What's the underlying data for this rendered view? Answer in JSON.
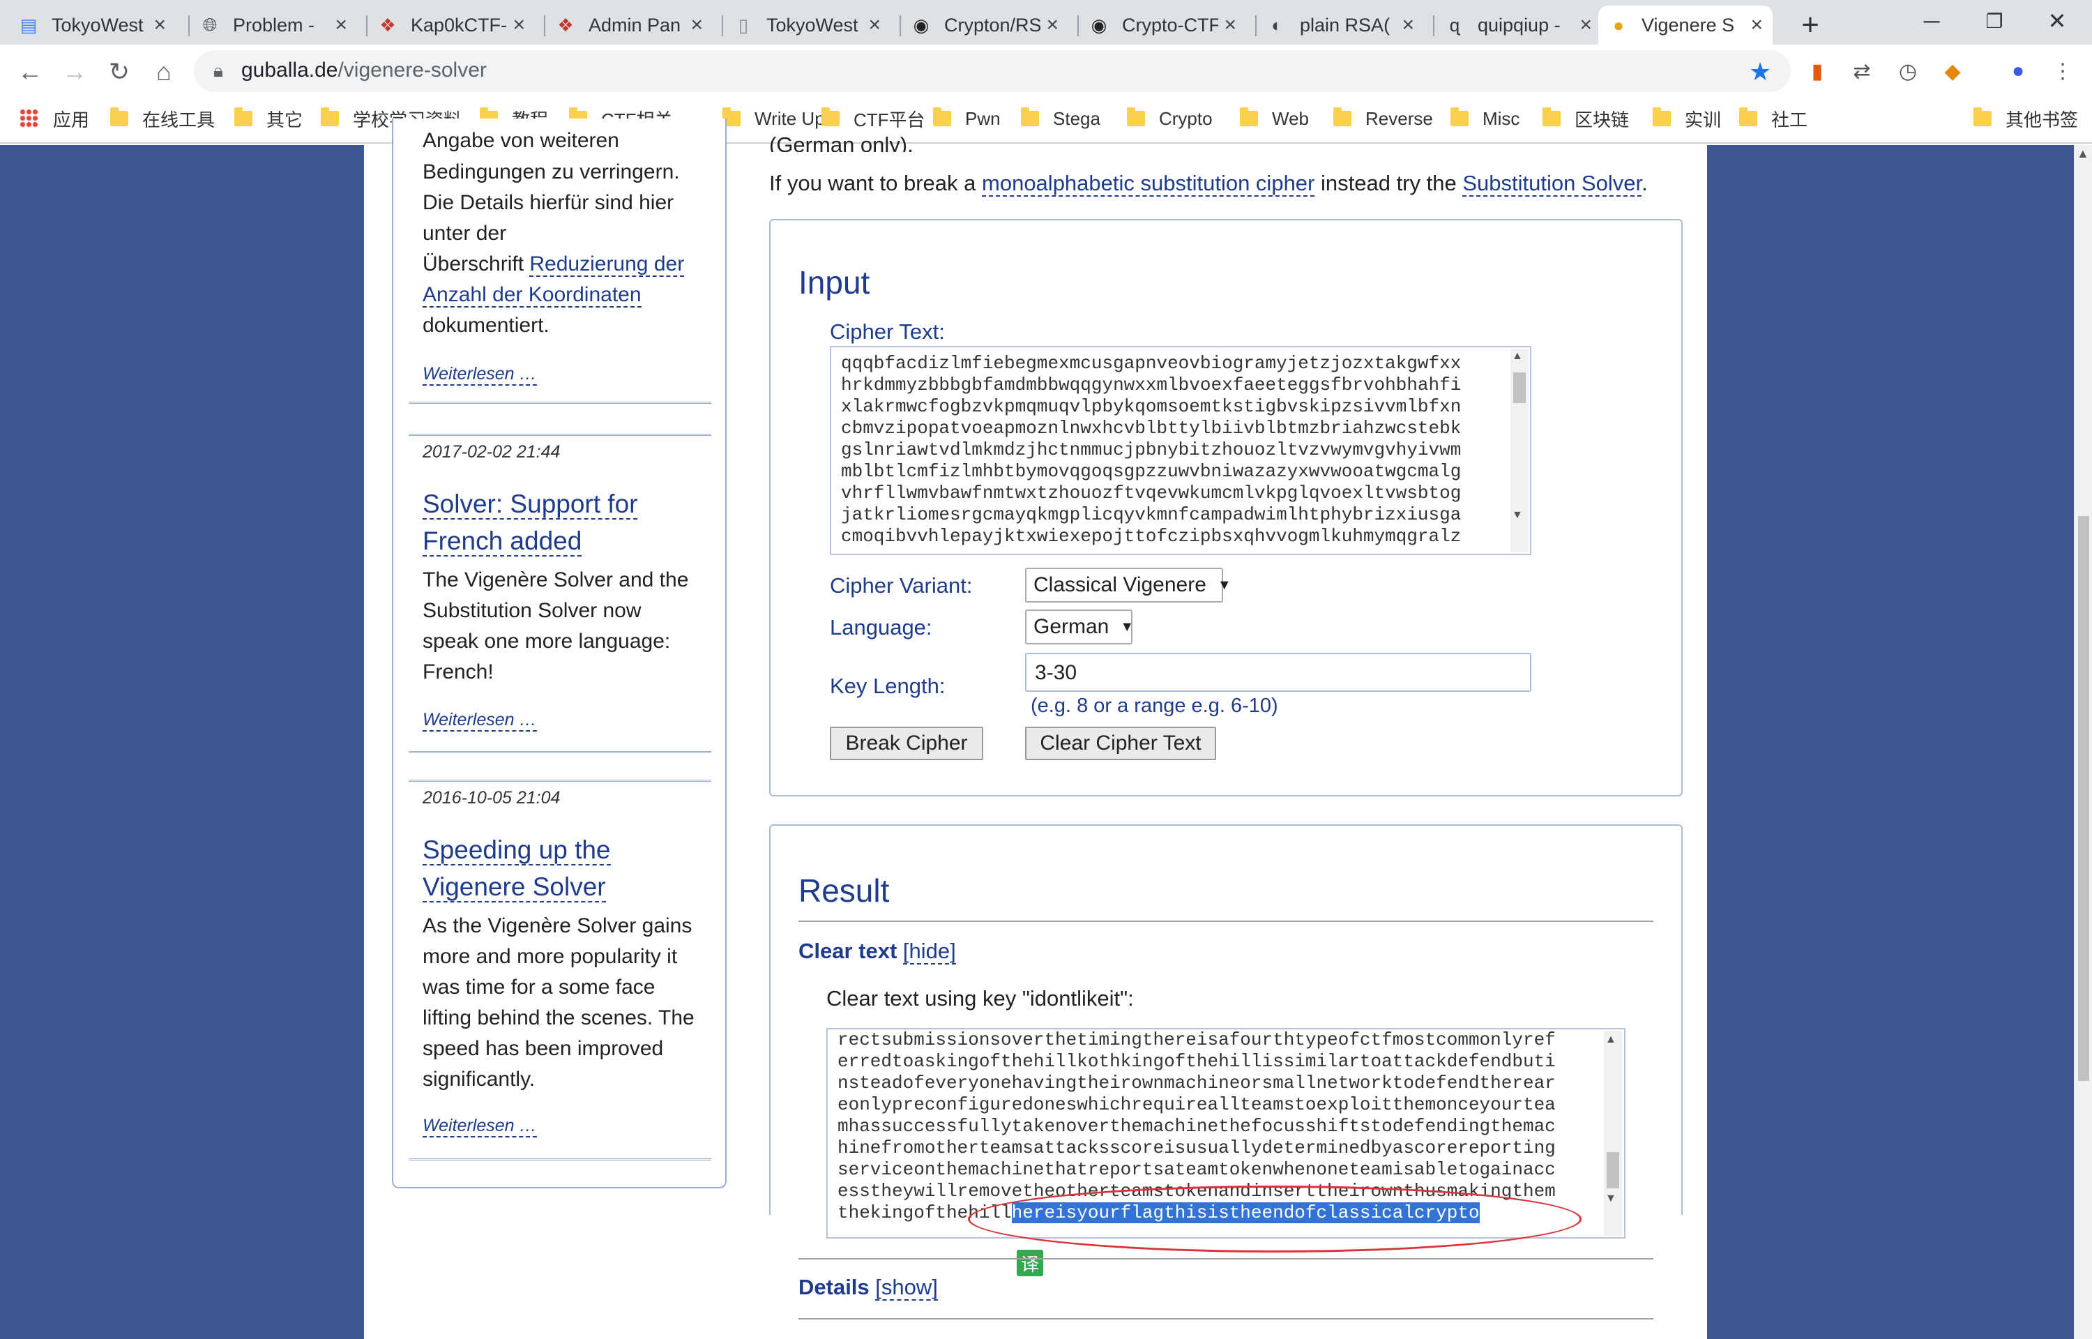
{
  "browser": {
    "tabs": [
      {
        "title": "TokyoWest",
        "icon": "docs-icon"
      },
      {
        "title": "Problem -",
        "icon": "globe-icon"
      },
      {
        "title": "Kap0kCTF-",
        "icon": "ctf-icon"
      },
      {
        "title": "Admin Pan",
        "icon": "ctf-icon"
      },
      {
        "title": "TokyoWest",
        "icon": "page-icon"
      },
      {
        "title": "Crypton/RS",
        "icon": "github-icon"
      },
      {
        "title": "Crypto-CTF",
        "icon": "github-icon"
      },
      {
        "title": "plain RSA(",
        "icon": "rsa-icon"
      },
      {
        "title": "quipqiup -",
        "icon": "q-icon"
      },
      {
        "title": "Vigenere S",
        "icon": "vigenere-icon"
      }
    ],
    "url_host": "guballa.de",
    "url_path": "/vigenere-solver",
    "bookmarks": [
      "应用",
      "在线工具",
      "其它",
      "学校学习资料",
      "教程",
      "CTF相关",
      "Write Up",
      "CTF平台",
      "Pwn",
      "Stega",
      "Crypto",
      "Web",
      "Reverse",
      "Misc",
      "区块链",
      "实训",
      "社工"
    ],
    "other_bookmarks": "其他书签",
    "accent_color": "#1a73e8"
  },
  "sidebar": {
    "partial_top": "Angabe von weiteren",
    "entry1_lines": [
      "Bedingungen zu verringern.",
      "Die Details hierfür sind hier",
      "unter der"
    ],
    "entry1_prefix": "Überschrift ",
    "entry1_link_a": "Reduzierung der",
    "entry1_link_b": "Anzahl der Koordinaten",
    "entry1_end": "dokumentiert.",
    "readmore": "Weiterlesen …",
    "news": [
      {
        "date": "2017-02-02 21:44",
        "title_a": "Solver: Support for",
        "title_b": "French added",
        "body": [
          "The Vigenère Solver and the",
          "Substitution Solver now",
          "speak one more language:",
          "French!"
        ]
      },
      {
        "date": "2016-10-05 21:04",
        "title_a": "Speeding up the",
        "title_b": "Vigenere Solver",
        "body": [
          "As the Vigenère Solver gains",
          "more and more popularity it",
          "was time for a some face",
          "lifting behind the scenes. The",
          "speed has been improved",
          "significantly."
        ]
      }
    ]
  },
  "main": {
    "clipped_top": "(German only).",
    "intro_prefix": "If you want to break a ",
    "intro_link1": "monoalphabetic substitution cipher",
    "intro_mid": " instead try the ",
    "intro_link2": "Substitution Solver",
    "intro_suffix": ".",
    "input": {
      "heading": "Input",
      "cipher_label": "Cipher Text:",
      "cipher_lines": [
        "qqqbfacdizlmfiebegmexmcusgapnveovbiogramyjetzjozxtakgwfxx",
        "hrkdmmyzbbbgbfamdmbbwqqgynwxxmlbvoexfaeeteggsfbrvohbhahfi",
        "xlakrmwcfogbzvkpmqmuqvlpbykqomsoemtkstigbvskipzsivvmlbfxn",
        "cbmvzipopatvoeapmoznlnwxhcvblbttylbiivblbtmzbriahzwcstebk",
        "gslnriawtvdlmkmdzjhctnmmucjpbnybitzhouozltvzvwymvgvhyivwm",
        "mblbtlcmfizlmhbtbymovqgoqsgpzzuwvbniwazazyxwvwooatwgcmalg",
        "vhrfllwmvbawfnmtwxtzhouozftvqevwkumcmlvkpglqvoexltvwsbtog",
        "jatkrliomesrgcmayqkmgplicqyvkmnfcampadwimlhtphybrizxiusga",
        "cmoqibvvhlepayjktxwiexepojttofczipbsxqhvvogmlkuhmymqgralz"
      ],
      "variant_label": "Cipher Variant:",
      "variant_value": "Classical Vigenere",
      "language_label": "Language:",
      "language_value": "German",
      "keylen_label": "Key Length:",
      "keylen_value": "3-30",
      "keylen_hint": "(e.g. 8 or a range e.g. 6-10)",
      "break_button": "Break Cipher",
      "clear_button": "Clear Cipher Text"
    },
    "result": {
      "heading": "Result",
      "cleartext_title": "Clear text",
      "hide_link": "[hide]",
      "key_label": "Clear text using key \"idontlikeit\":",
      "clear_lines": [
        "rectsubmissionsoverthetimingthereisafourthtypeofctfmostcommonlyref",
        "erredtoaskingofthehillkothkingofthehillissimilartoattackdefendbuti",
        "nsteadofeveryonehavingtheirownmachineorsmallnetworktodefendtherear",
        "eonlypreconfiguredoneswhichrequireallteamstoexploitthemonceyourtea",
        "mhassuccessfullytakenoverthemachinethefocusshiftstodefendingthemac",
        "hinefromotherteamsattacksscoreisusuallydeterminedbyascorereporting",
        "serviceonthemachinethatreportsateamtokenwhenoneteamisabletogainacc",
        "esstheywillremovetheotherteamstokenandinserttheirownthusmakingthem"
      ],
      "last_line_plain": "thekingofthehill",
      "last_line_selected": "hereisyourflagthisistheendofclassicalcrypto",
      "details_title": "Details",
      "show_link": "[show]",
      "translate_icon_label": "译",
      "annotation_color": "#d9343a"
    }
  }
}
